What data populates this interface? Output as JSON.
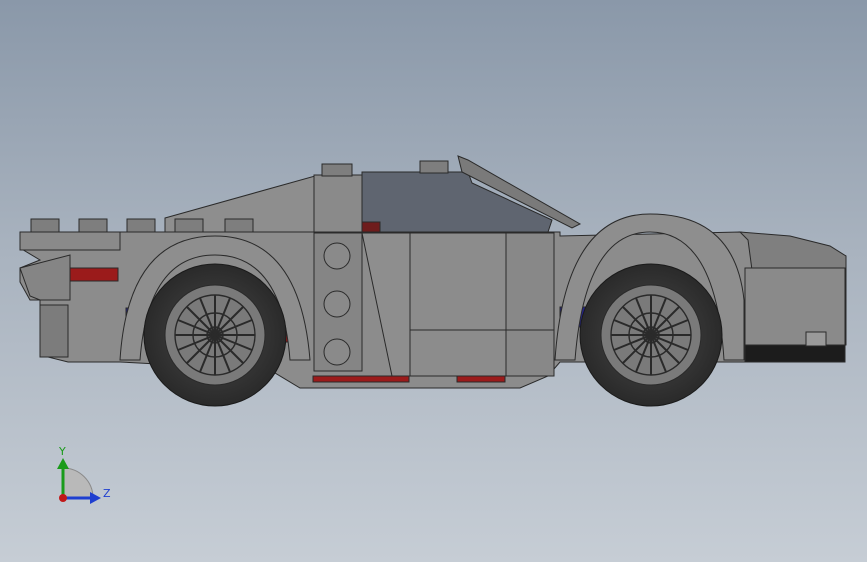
{
  "viewport": {
    "background_top": "#8a98a9",
    "background_bottom": "#c6cdd5"
  },
  "model": {
    "name_icon": "car-model",
    "body_color": "#8c8c8c",
    "dark_color": "#5b5f66",
    "stripe_red": "#9b1b1b",
    "stripe_blue": "#23238a"
  },
  "triad": {
    "y_label": "Y",
    "z_label": "Z",
    "y_color": "#1a9b1a",
    "z_color": "#1f3fd0",
    "origin_color": "#c01818"
  }
}
